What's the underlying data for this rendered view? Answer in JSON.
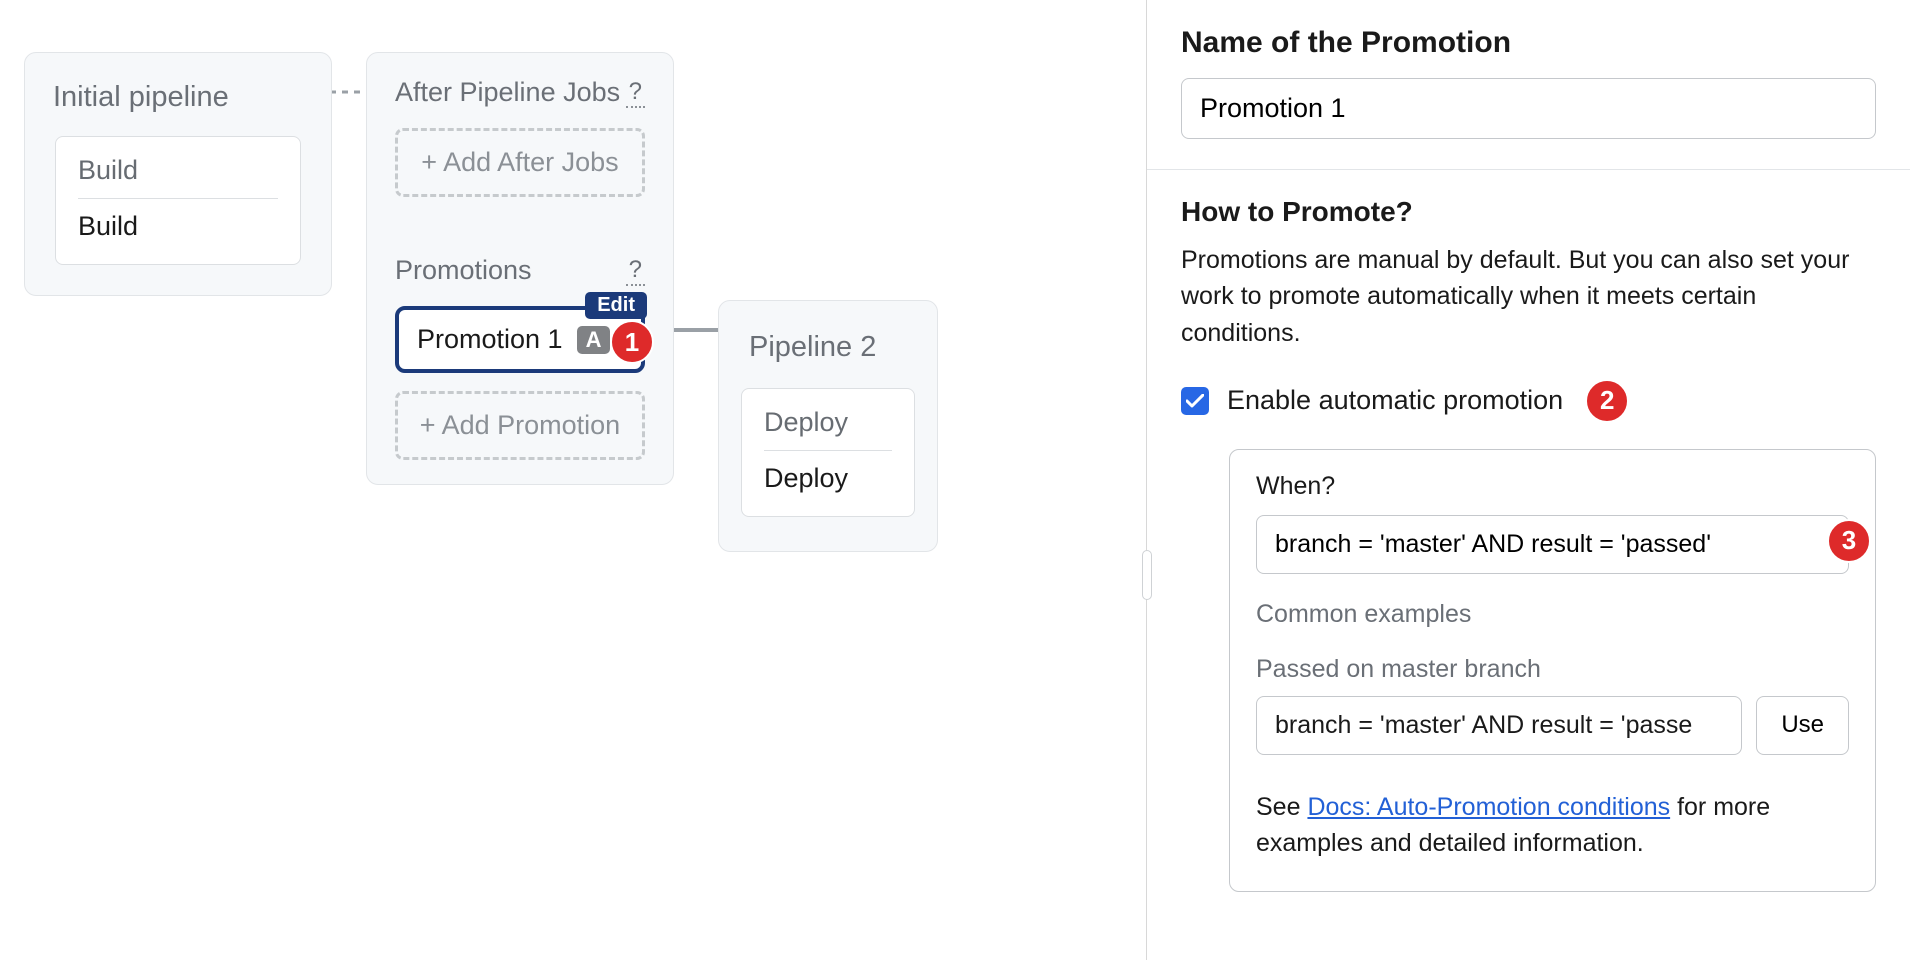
{
  "callouts": {
    "one": "1",
    "two": "2",
    "three": "3"
  },
  "canvas": {
    "initial": {
      "title": "Initial pipeline",
      "block": {
        "heading": "Build",
        "job": "Build"
      }
    },
    "after": {
      "heading": "After Pipeline Jobs",
      "help": "?",
      "add_label": "+ Add After Jobs"
    },
    "promotions": {
      "heading": "Promotions",
      "help": "?",
      "item": {
        "name": "Promotion 1",
        "badge": "A",
        "edit": "Edit"
      },
      "add_label": "+ Add Promotion"
    },
    "pipeline2": {
      "title": "Pipeline 2",
      "block": {
        "heading": "Deploy",
        "job": "Deploy"
      }
    }
  },
  "sidebar": {
    "name_heading": "Name of the Promotion",
    "name_value": "Promotion 1",
    "how_heading": "How to Promote?",
    "how_desc": "Promotions are manual by default. But you can also set your work to promote automatically when it meets certain conditions.",
    "enable_label": "Enable automatic promotion",
    "when": {
      "label": "When?",
      "value": "branch = 'master' AND result = 'passed'",
      "common_heading": "Common examples",
      "example_label": "Passed on master branch",
      "example_value": "branch = 'master' AND result = 'passe",
      "use_label": "Use",
      "docs_prefix": "See ",
      "docs_link": "Docs: Auto-Promotion conditions",
      "docs_suffix": " for more examples and detailed information."
    }
  }
}
